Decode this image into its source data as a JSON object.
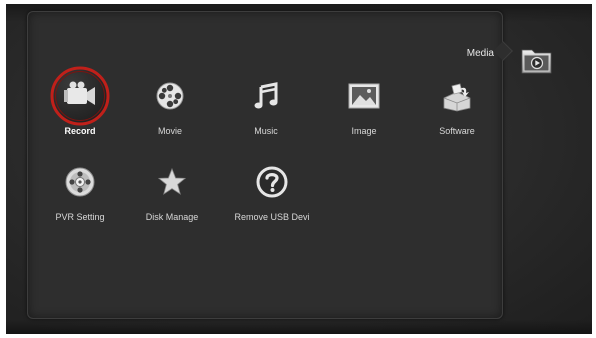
{
  "header": {
    "category_title": "Media",
    "category_icon": "media-folder-icon"
  },
  "menu": {
    "selected_index": 0,
    "accent_color": "#c0201a",
    "items": [
      {
        "label": "Record",
        "icon": "video-camera-icon"
      },
      {
        "label": "Movie",
        "icon": "film-reel-icon"
      },
      {
        "label": "Music",
        "icon": "music-note-icon"
      },
      {
        "label": "Image",
        "icon": "picture-icon"
      },
      {
        "label": "Software",
        "icon": "software-box-icon"
      },
      {
        "label": "PVR Setting",
        "icon": "pvr-disc-icon"
      },
      {
        "label": "Disk Manage",
        "icon": "star-icon"
      },
      {
        "label": "Remove USB Devi",
        "icon": "question-icon"
      }
    ]
  }
}
